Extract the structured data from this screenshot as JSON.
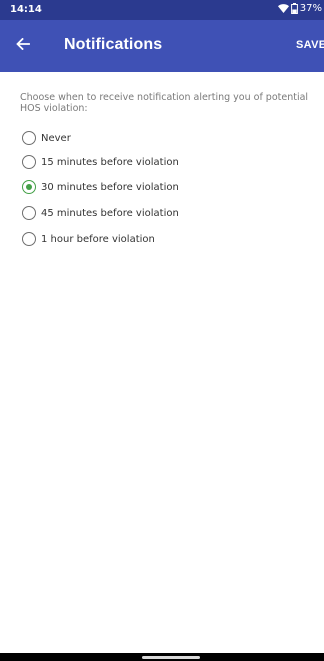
{
  "status_bar": {
    "time": "14:14",
    "battery": "37%"
  },
  "app_bar": {
    "title": "Notifications",
    "save_label": "SAVE",
    "back_icon": "arrow-back-icon"
  },
  "content": {
    "description": "Choose when to receive notification alerting you of potential HOS violation:",
    "options": [
      {
        "label": "Never",
        "checked": false
      },
      {
        "label": "15 minutes before violation",
        "checked": false
      },
      {
        "label": "30 minutes before violation",
        "checked": true
      },
      {
        "label": "45 minutes before violation",
        "checked": false
      },
      {
        "label": "1 hour before violation",
        "checked": false
      }
    ]
  },
  "colors": {
    "status_bar": "#2b3a8f",
    "app_bar": "#3f51b5",
    "selected": "#43a047"
  }
}
